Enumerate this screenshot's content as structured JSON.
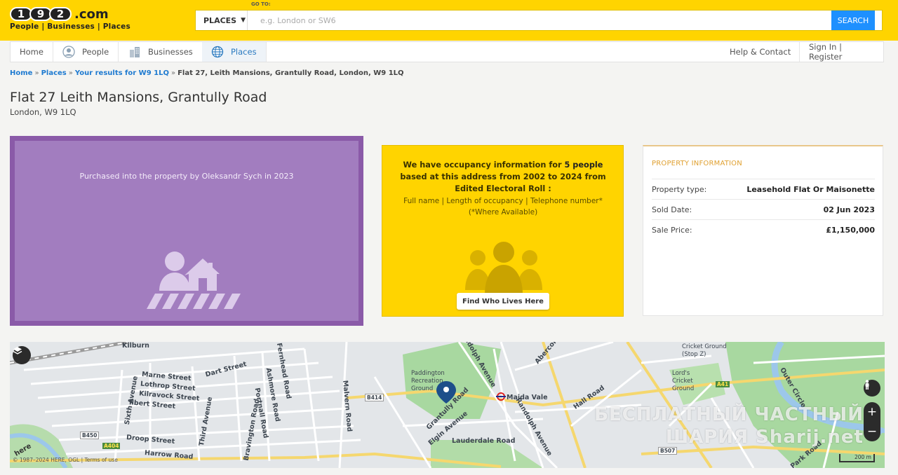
{
  "header": {
    "logo_digits": [
      "1",
      "9",
      "2"
    ],
    "logo_suffix": ".com",
    "logo_tagline": "People | Businesses | Places",
    "goto_label": "GO TO:",
    "search_type": "PLACES",
    "search_placeholder": "e.g. London or SW6",
    "search_button": "SEARCH"
  },
  "nav": {
    "items": [
      {
        "label": "Home",
        "icon": "home"
      },
      {
        "label": "People",
        "icon": "person-icon"
      },
      {
        "label": "Businesses",
        "icon": "buildings-icon"
      },
      {
        "label": "Places",
        "icon": "globe-icon"
      }
    ],
    "help": "Help & Contact",
    "signin": "Sign In | Register",
    "active_color": "#2a7ac0"
  },
  "breadcrumb": {
    "home": "Home",
    "places": "Places",
    "results": "Your results for W9 1LQ",
    "current": "Flat 27, Leith Mansions, Grantully Road, London, W9 1LQ"
  },
  "page": {
    "title": "Flat 27 Leith Mansions, Grantully Road",
    "subtitle": "London, W9 1LQ"
  },
  "purchase_card": {
    "text": "Purchased into the property by Oleksandr Sych in 2023",
    "color": "#a27dbf"
  },
  "occupancy_card": {
    "line_prefix": "We have occupancy information for ",
    "count_text": "5 people",
    "line_suffix": " based at this address from 2002 to 2024 from Edited Electoral Roll :",
    "details": "Full name | Length of occupancy | Telephone number* (*Where Available)",
    "button": "Find Who Lives Here",
    "color": "#ffd400"
  },
  "property_info": {
    "title": "PROPERTY INFORMATION",
    "rows": [
      {
        "key": "Property type:",
        "value": "Leasehold Flat Or Maisonette"
      },
      {
        "key": "Sold Date:",
        "value": "02 Jun 2023"
      },
      {
        "key": "Sale Price:",
        "value": "£1,150,000"
      }
    ]
  },
  "map": {
    "labels": {
      "kilburn": "Kilburn",
      "marne": "Marne Street",
      "lothrop": "Lothrop Street",
      "kilravock": "Kilravock Street",
      "ilbert": "Ilbert Street",
      "dart": "Dart Street",
      "sixth": "Sixth Avenue",
      "third": "Third Avenue",
      "fernhead": "Fernhead Road",
      "ashmore": "Ashmore Road",
      "portnall": "Portnall Road",
      "bravington": "Bravington Road",
      "droop": "Droop Street",
      "harrow": "Harrow Road",
      "malvern": "Malvern Road",
      "paddington": "Paddington Recreation Ground",
      "randolph": "Randolph Avenue",
      "grantully": "Grantully Road",
      "elgin": "Elgin Avenue",
      "lauderdale": "Lauderdale Road",
      "maida": "Maida Vale",
      "hall": "Hall Road",
      "abercorn": "Abercorn",
      "cricket1": "Cricket Ground (Stop Z)",
      "lords": "Lord's Cricket Ground",
      "outer": "Outer Circle",
      "park": "Park Road",
      "b414": "B414",
      "b450": "B450",
      "a404": "A404",
      "a41": "A41",
      "b507": "B507"
    },
    "copyright": "© 1987–2024 HERE, OGL | Terms of use",
    "scale": "200 m",
    "here": "here",
    "watermark_line1": "БЕСПЛАТНЫЙ ЧАСТНЫЙ",
    "watermark_line2": "ШАРИЯ Sharij.net"
  }
}
